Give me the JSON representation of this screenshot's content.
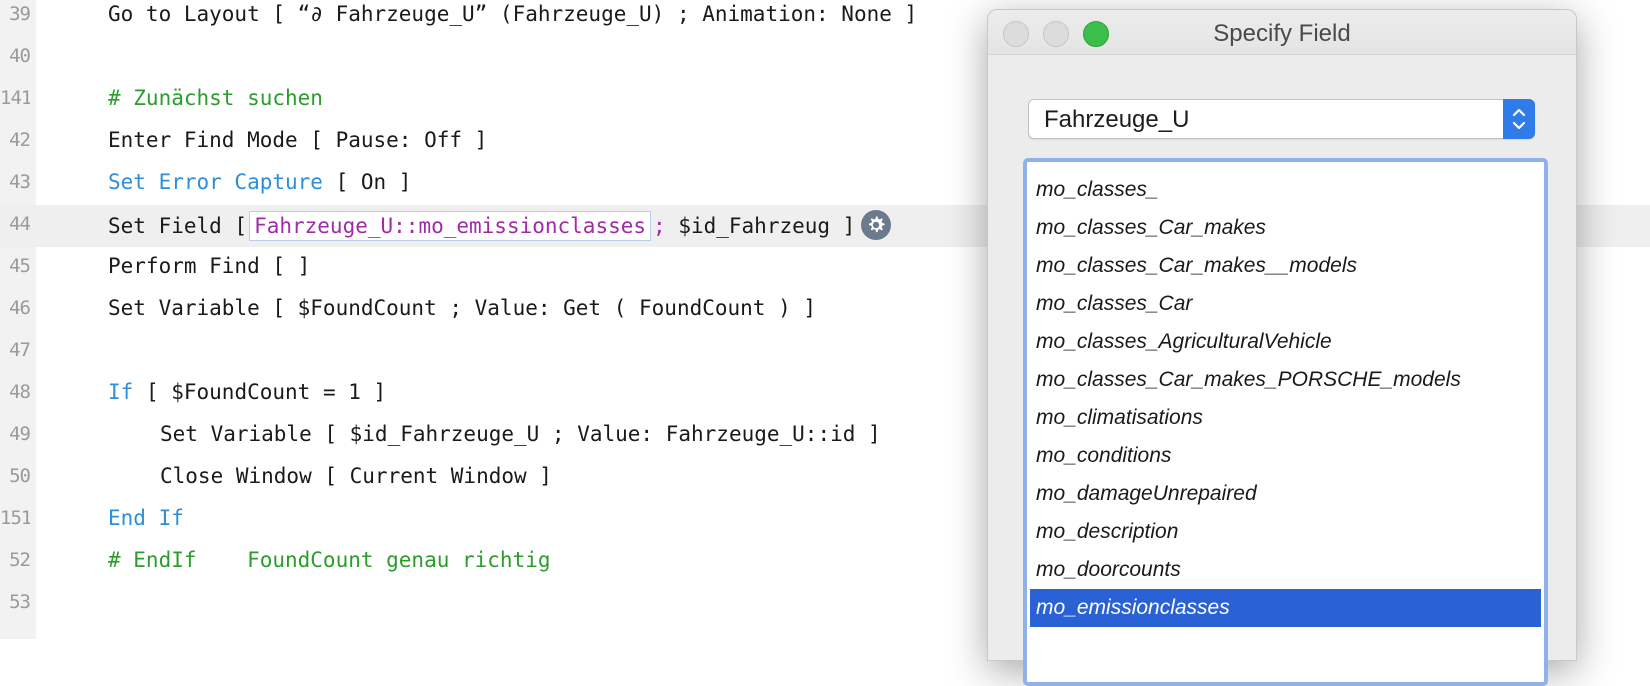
{
  "editor": {
    "lines": [
      {
        "num": "39",
        "segments": [
          {
            "text": "Go to Layout [ “∂ Fahrzeuge_U” (Fahrzeuge_U) ; Animation: None ]",
            "cls": ""
          }
        ]
      },
      {
        "num": "40",
        "segments": []
      },
      {
        "num": "141",
        "segments": [
          {
            "text": "# Zunächst suchen",
            "cls": "comment"
          }
        ]
      },
      {
        "num": "42",
        "segments": [
          {
            "text": "Enter Find Mode [ Pause: Off ]",
            "cls": ""
          }
        ]
      },
      {
        "num": "43",
        "segments": [
          {
            "text": "Set Error Capture",
            "cls": "kw-blue"
          },
          {
            "text": " [ On ]",
            "cls": ""
          }
        ]
      },
      {
        "num": "44",
        "active": true,
        "segments": [
          {
            "text": "Set Field [",
            "cls": ""
          },
          {
            "text": "Fahrzeuge_U::mo_emissionclasses",
            "cls": "field-token"
          },
          {
            "text": ";",
            "cls": "semi"
          },
          {
            "text": " $id_Fahrzeug ]",
            "cls": ""
          }
        ]
      },
      {
        "num": "45",
        "segments": [
          {
            "text": "Perform Find [ ]",
            "cls": ""
          }
        ]
      },
      {
        "num": "46",
        "segments": [
          {
            "text": "Set Variable [ $FoundCount ; Value: Get ( FoundCount ) ]",
            "cls": ""
          }
        ]
      },
      {
        "num": "47",
        "segments": []
      },
      {
        "num": "48",
        "segments": [
          {
            "text": "If",
            "cls": "kw-blue"
          },
          {
            "text": " [ $FoundCount = 1 ]",
            "cls": ""
          }
        ]
      },
      {
        "num": "49",
        "indent": 2,
        "segments": [
          {
            "text": "Set Variable [ $id_Fahrzeuge_U ; Value: Fahrzeuge_U::id ]",
            "cls": ""
          }
        ]
      },
      {
        "num": "50",
        "indent": 2,
        "segments": [
          {
            "text": "Close Window [ Current Window ]",
            "cls": ""
          }
        ]
      },
      {
        "num": "151",
        "segments": [
          {
            "text": "End If",
            "cls": "kw-blue"
          }
        ]
      },
      {
        "num": "52",
        "segments": [
          {
            "text": "# EndIf    FoundCount genau richtig",
            "cls": "comment"
          }
        ]
      },
      {
        "num": "53",
        "segments": []
      }
    ]
  },
  "dialog": {
    "title": "Specify Field",
    "table_select": {
      "value": "Fahrzeuge_U"
    },
    "fields": [
      "mo_classes_",
      "mo_classes_Car_makes",
      "mo_classes_Car_makes__models",
      "mo_classes_Car",
      "mo_classes_AgriculturalVehicle",
      "mo_classes_Car_makes_PORSCHE_models",
      "mo_climatisations",
      "mo_conditions",
      "mo_damageUnrepaired",
      "mo_description",
      "mo_doorcounts",
      "mo_emissionclasses"
    ],
    "selected_field": "mo_emissionclasses"
  },
  "colors": {
    "selection": "#2a62d6",
    "keyword": "#2f8ed9",
    "comment": "#2a9d2a",
    "field_reference": "#a12aa8",
    "zoom_button": "#3dbe4a"
  },
  "icons": {
    "gear": "gear-icon",
    "stepper": "chevron-up-down-icon"
  }
}
